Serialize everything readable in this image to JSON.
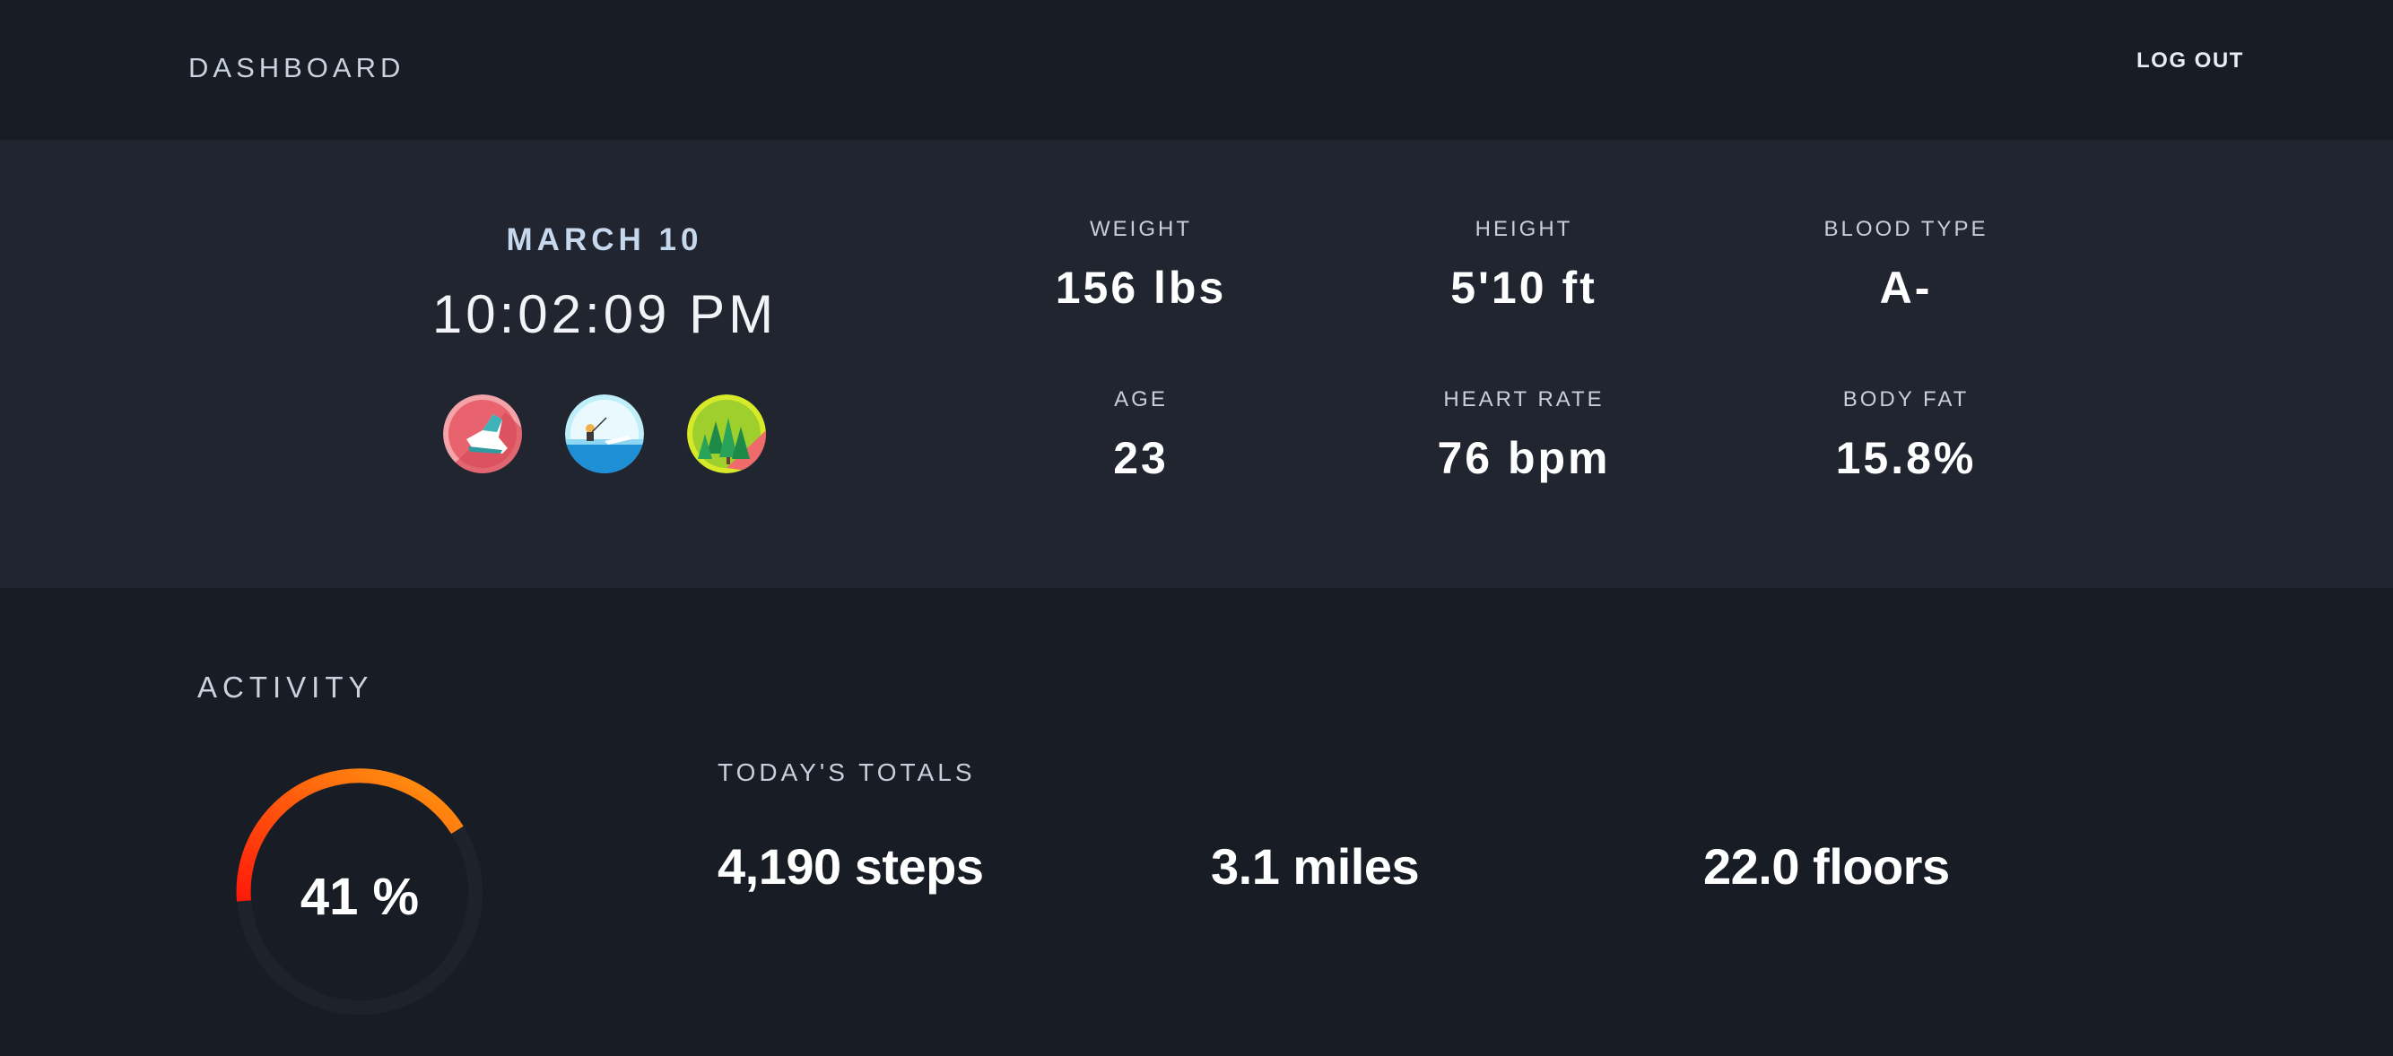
{
  "header": {
    "title": "DASHBOARD",
    "logout_label": "LOG OUT"
  },
  "profile": {
    "date": "MARCH 10",
    "time": "10:02:09 PM",
    "badges": [
      {
        "name": "sneaker-badge",
        "color": "#e8636e"
      },
      {
        "name": "fishing-badge",
        "color": "#7fdcf0"
      },
      {
        "name": "forest-badge",
        "color": "#c8e02a"
      }
    ],
    "stats": [
      {
        "label": "WEIGHT",
        "value": "156 lbs"
      },
      {
        "label": "HEIGHT",
        "value": "5'10 ft"
      },
      {
        "label": "BLOOD TYPE",
        "value": "A-"
      },
      {
        "label": "AGE",
        "value": "23"
      },
      {
        "label": "HEART RATE",
        "value": "76 bpm"
      },
      {
        "label": "BODY FAT",
        "value": "15.8%"
      }
    ]
  },
  "activity": {
    "title": "ACTIVITY",
    "progress_percent": 41,
    "progress_label": "41 %",
    "totals_label": "TODAY'S TOTALS",
    "totals": [
      {
        "value": "4,190 steps"
      },
      {
        "value": "3.1 miles"
      },
      {
        "value": "22.0 floors"
      }
    ]
  },
  "colors": {
    "background": "#181c24",
    "band": "#202530",
    "ring_start": "#ff1a0a",
    "ring_end": "#ff9a10",
    "ring_track": "#1e222b"
  }
}
